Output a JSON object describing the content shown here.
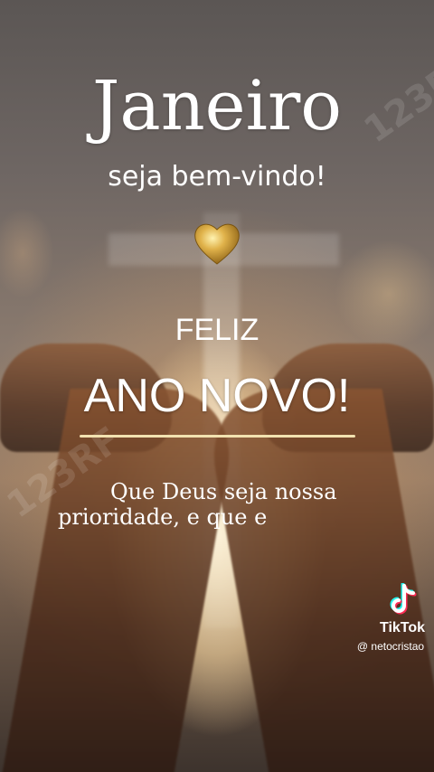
{
  "post": {
    "title": "Janeiro",
    "subtitle": "seja bem-vindo!",
    "greeting_small": "FELIZ",
    "greeting_large": "ANO NOVO!",
    "message_line1": "Que Deus seja nossa",
    "message_line2": "prioridade, e que e"
  },
  "watermark": {
    "text": "123RF"
  },
  "tiktok": {
    "brand": "TikTok",
    "username": "@ netocristao"
  },
  "icons": {
    "heart": "gold-heart-icon",
    "tiktok": "tiktok-note-icon"
  },
  "colors": {
    "text": "#ffffff",
    "rule": "#f2e2b0",
    "heart_gold": "#d4a23a",
    "tiktok_cyan": "#25f4ee",
    "tiktok_red": "#fe2c55"
  }
}
